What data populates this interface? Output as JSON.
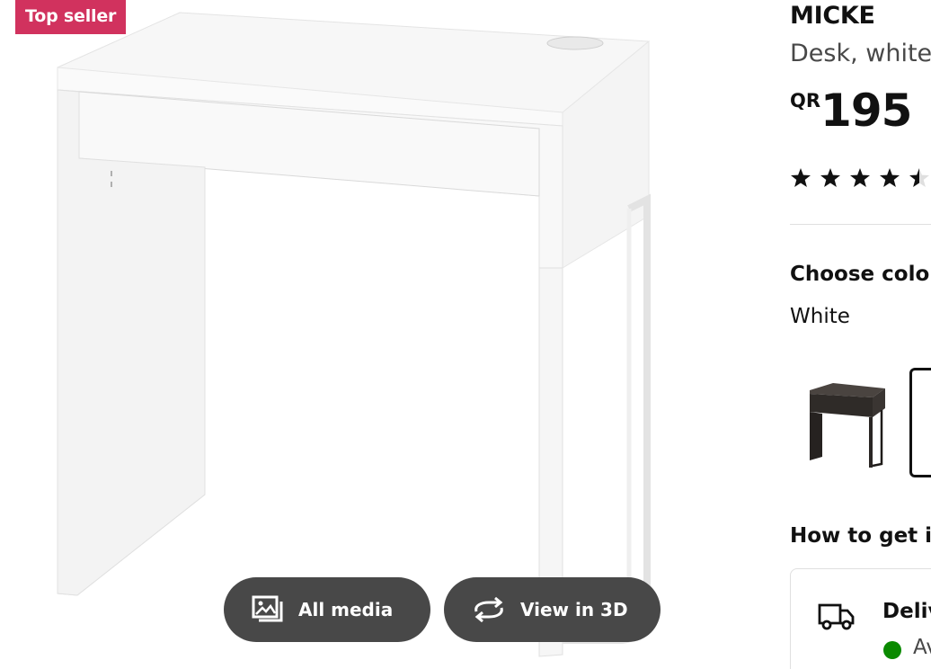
{
  "badge": {
    "label": "Top seller",
    "color": "#d1325e"
  },
  "media": {
    "all_media_label": "All media",
    "all_media_icon": "image-gallery-icon",
    "view_3d_label": "View in 3D",
    "view_3d_icon": "rotate-3d-icon"
  },
  "product": {
    "name": "MICKE",
    "description": "Desk, white",
    "price_currency": "QR",
    "price_amount": "195",
    "rating": 4.5,
    "rating_max": 5
  },
  "colour": {
    "heading": "Choose colour",
    "selected": "White",
    "options": [
      "black-brown",
      "white"
    ]
  },
  "delivery": {
    "heading": "How to get it",
    "title": "Delivery",
    "icon": "truck-icon",
    "stock_text": "Available",
    "stock_color": "#0a8a00"
  }
}
